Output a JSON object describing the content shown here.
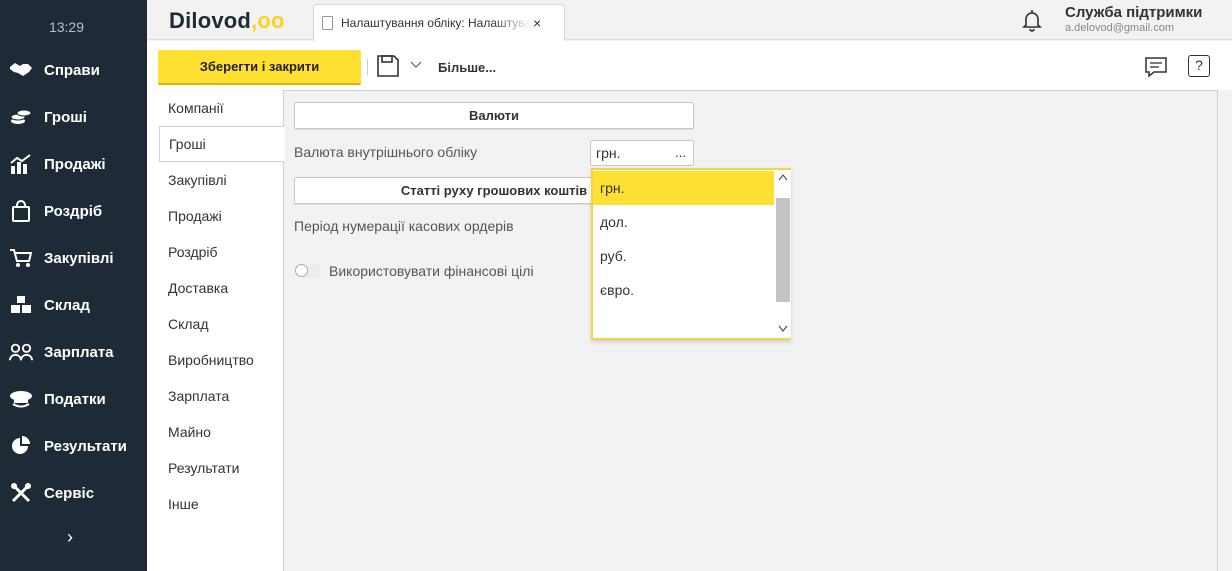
{
  "sidebar": {
    "clock": "13:29",
    "items": [
      {
        "label": "Справи",
        "icon": "handshake-icon"
      },
      {
        "label": "Гроші",
        "icon": "coins-icon"
      },
      {
        "label": "Продажі",
        "icon": "chart-icon"
      },
      {
        "label": "Роздріб",
        "icon": "shopping-bag-icon"
      },
      {
        "label": "Закупівлі",
        "icon": "cart-icon"
      },
      {
        "label": "Склад",
        "icon": "boxes-icon"
      },
      {
        "label": "Зарплата",
        "icon": "people-icon"
      },
      {
        "label": "Податки",
        "icon": "officer-cap-icon"
      },
      {
        "label": "Результати",
        "icon": "pie-chart-icon"
      },
      {
        "label": "Сервіс",
        "icon": "tools-icon"
      }
    ],
    "expand_glyph": "›"
  },
  "header": {
    "logo_text": "Dilovod",
    "logo_dots": ",oo",
    "tab_title": "Налаштування обліку: Налаштування",
    "tab_close": "×",
    "support_name": "Служба підтримки",
    "support_email": "a.delovod@gmail.com"
  },
  "toolbar": {
    "save_label": "Зберегти і закрити",
    "more_label": "Більше...",
    "help_label": "?"
  },
  "settings_menu": {
    "items": [
      "Компанії",
      "Гроші",
      "Закупівлі",
      "Продажі",
      "Роздріб",
      "Доставка",
      "Склад",
      "Виробництво",
      "Зарплата",
      "Майно",
      "Результати",
      "Інше"
    ],
    "active": "Гроші"
  },
  "main": {
    "currencies_button": "Валюти",
    "internal_currency_label": "Валюта внутрішнього обліку",
    "internal_currency_value": "грн.",
    "select_dots": "...",
    "cash_flow_button": "Статті руху грошових коштів",
    "cash_order_period_label": "Період нумерації касових ордерів",
    "financial_goals_label": "Використовувати фінансові цілі"
  },
  "dropdown": {
    "options": [
      "грн.",
      "дол.",
      "руб.",
      "євро."
    ],
    "selected": "грн."
  },
  "colors": {
    "sidebar_bg": "#1e2a36",
    "accent_yellow": "#ffe033"
  }
}
